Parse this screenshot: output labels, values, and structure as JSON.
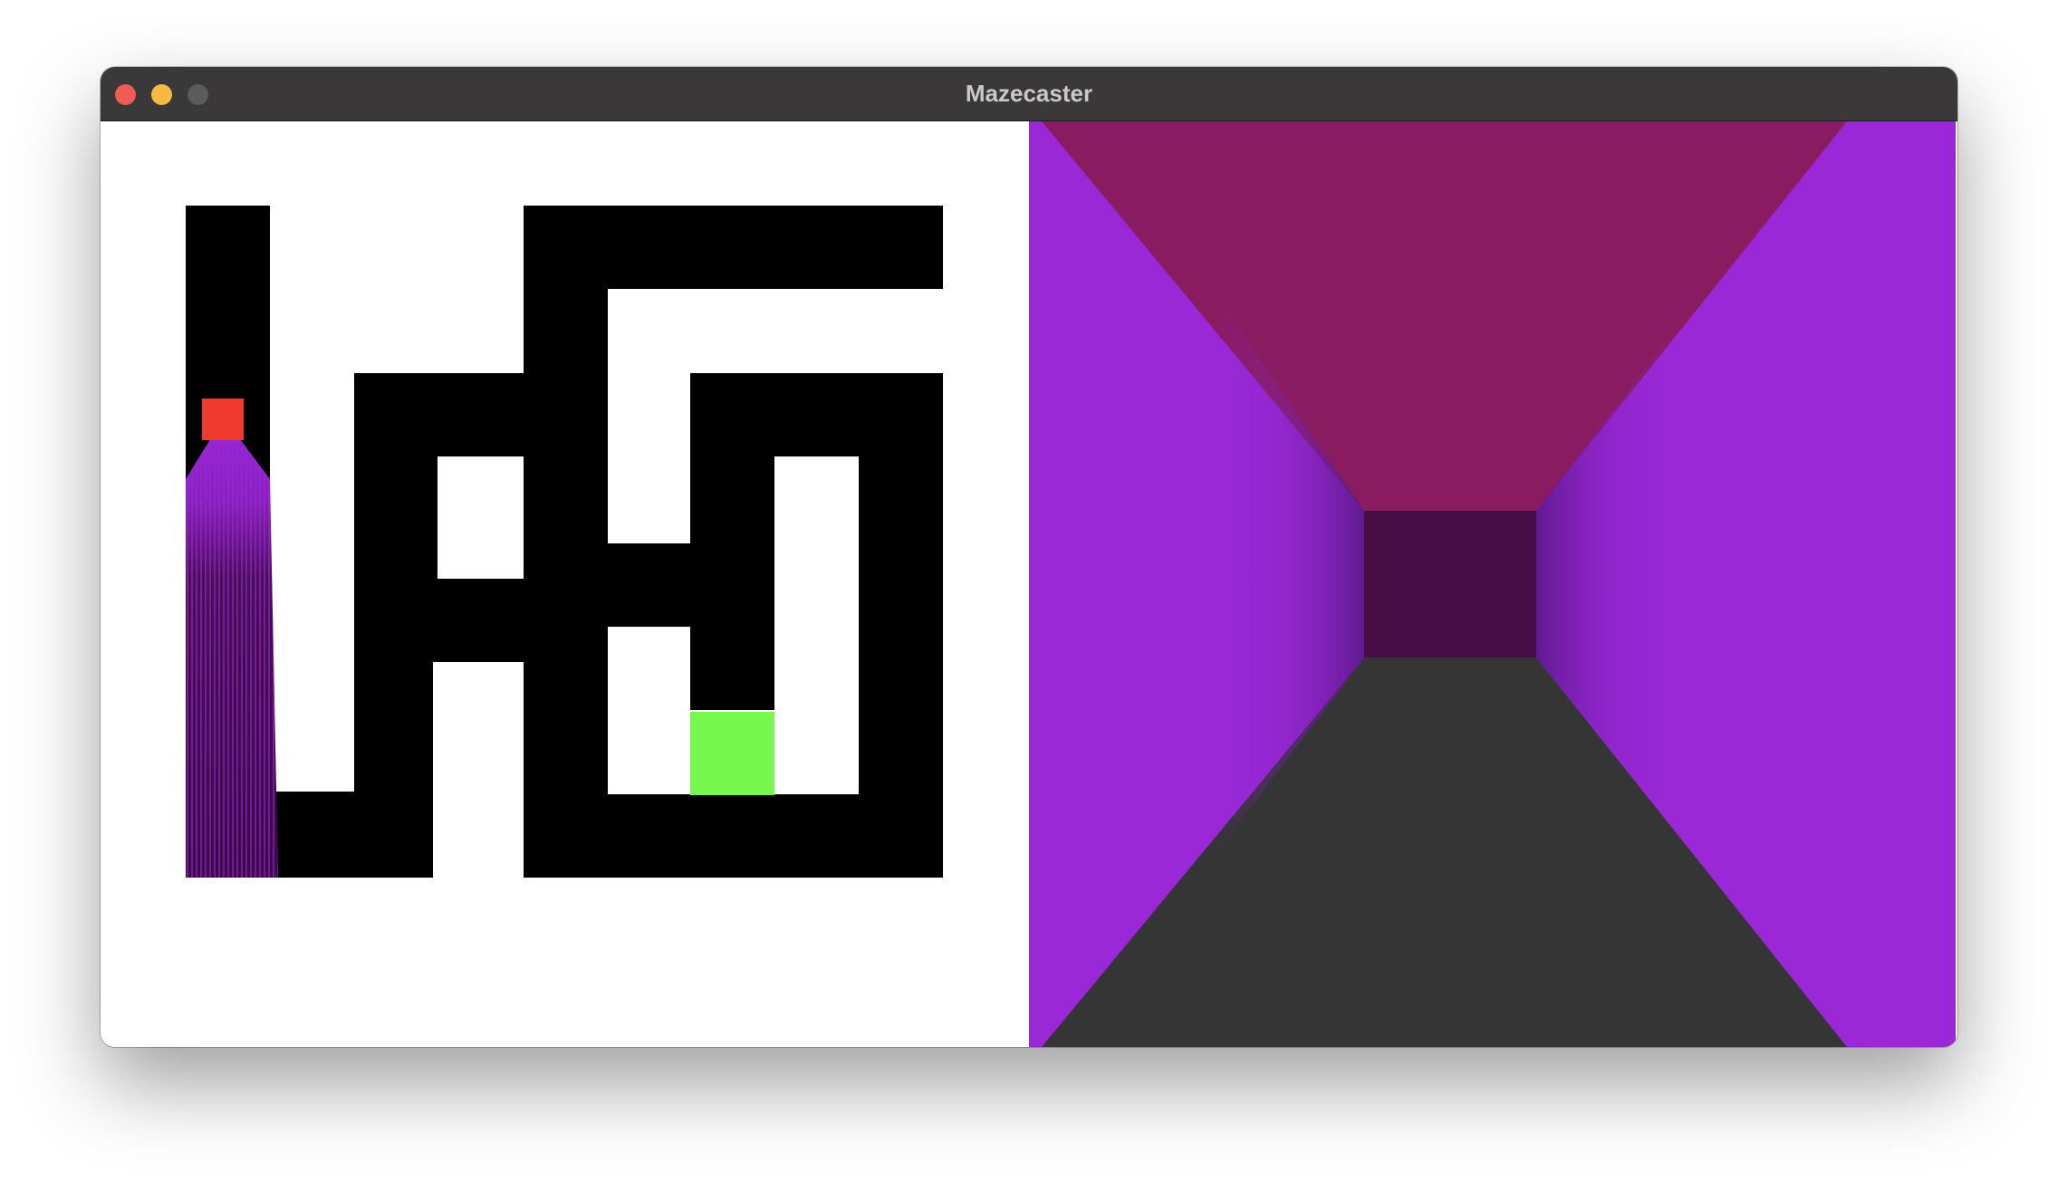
{
  "window": {
    "title": "Mazecaster"
  },
  "colors": {
    "titlebar": "#3a3838",
    "close_light": "#ee5c55",
    "minimize_light": "#f3bb3f",
    "zoom_light": "#5c5b5b",
    "map_background": "#ffffff",
    "maze_path": "#000000",
    "player": "#f03a2f",
    "goal": "#78f74e",
    "ray_fan": "#9a28d6",
    "ceiling": "#891c60",
    "floor": "#353535",
    "wall_side": "#9a28d6",
    "wall_far": "#470e45"
  },
  "icons": {
    "close": "close-circle-icon",
    "minimize": "minimize-circle-icon",
    "zoom": "zoom-circle-icon"
  }
}
